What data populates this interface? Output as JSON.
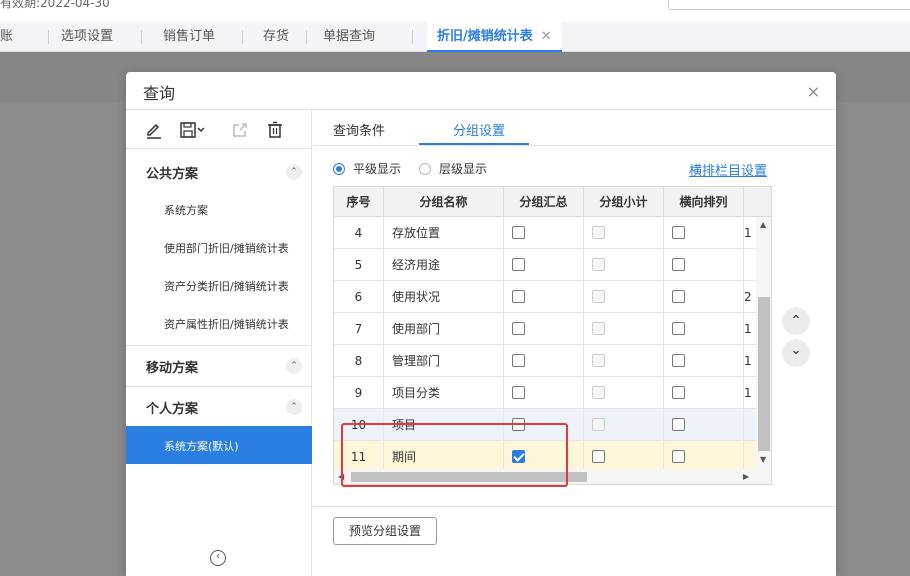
{
  "topbar": {
    "date_text": "有效期:2022-04-30"
  },
  "tabs": [
    {
      "label": "账"
    },
    {
      "label": "选项设置"
    },
    {
      "label": "销售订单"
    },
    {
      "label": "存货"
    },
    {
      "label": "单据查询"
    },
    {
      "label": "折旧/摊销统计表",
      "active": true
    }
  ],
  "tab_close_glyph": "✕",
  "dialog": {
    "title": "查询",
    "close_glyph": "×"
  },
  "left_panel": {
    "toolbar_icons": [
      "edit-icon",
      "save-icon",
      "export-icon",
      "delete-icon"
    ],
    "sections": [
      {
        "label": "公共方案",
        "items": [
          "系统方案",
          "使用部门折旧/摊销统计表",
          "资产分类折旧/摊销统计表",
          "资产属性折旧/摊销统计表"
        ]
      },
      {
        "label": "移动方案",
        "items": []
      },
      {
        "label": "个人方案",
        "items": [
          "系统方案(默认)"
        ]
      }
    ],
    "chevron_glyph": "⌃",
    "collapse_glyph": "‹"
  },
  "right_panel": {
    "tabs": [
      "查询条件",
      "分组设置"
    ],
    "active_tab": "分组设置",
    "radios": [
      {
        "label": "平级显示",
        "checked": true
      },
      {
        "label": "层级显示",
        "checked": false
      }
    ],
    "link": "横排栏目设置",
    "grid": {
      "columns": [
        "序号",
        "分组名称",
        "分组汇总",
        "分组小计",
        "横向排列"
      ],
      "rows": [
        {
          "no": "4",
          "name": "存放位置",
          "summary": false,
          "subtotal": false,
          "horizontal": false,
          "extra": "1"
        },
        {
          "no": "5",
          "name": "经济用途",
          "summary": false,
          "subtotal": false,
          "horizontal": false,
          "extra": ""
        },
        {
          "no": "6",
          "name": "使用状况",
          "summary": false,
          "subtotal": false,
          "horizontal": false,
          "extra": "2"
        },
        {
          "no": "7",
          "name": "使用部门",
          "summary": false,
          "subtotal": false,
          "horizontal": false,
          "extra": "1"
        },
        {
          "no": "8",
          "name": "管理部门",
          "summary": false,
          "subtotal": false,
          "horizontal": false,
          "extra": "1"
        },
        {
          "no": "9",
          "name": "项目分类",
          "summary": false,
          "subtotal": false,
          "horizontal": false,
          "extra": "1"
        },
        {
          "no": "10",
          "name": "项目",
          "summary": false,
          "subtotal": false,
          "horizontal": false,
          "extra": ""
        },
        {
          "no": "11",
          "name": "期间",
          "summary": true,
          "subtotal": false,
          "horizontal": false,
          "extra": ""
        }
      ]
    },
    "up_glyph": "⌃",
    "down_glyph": "⌄",
    "preview_button": "预览分组设置"
  },
  "colors": {
    "accent": "#2a7de1",
    "highlight_border": "#e23b3b",
    "selected_row": "#fdf6d8",
    "hover_row": "#eef3fb"
  }
}
